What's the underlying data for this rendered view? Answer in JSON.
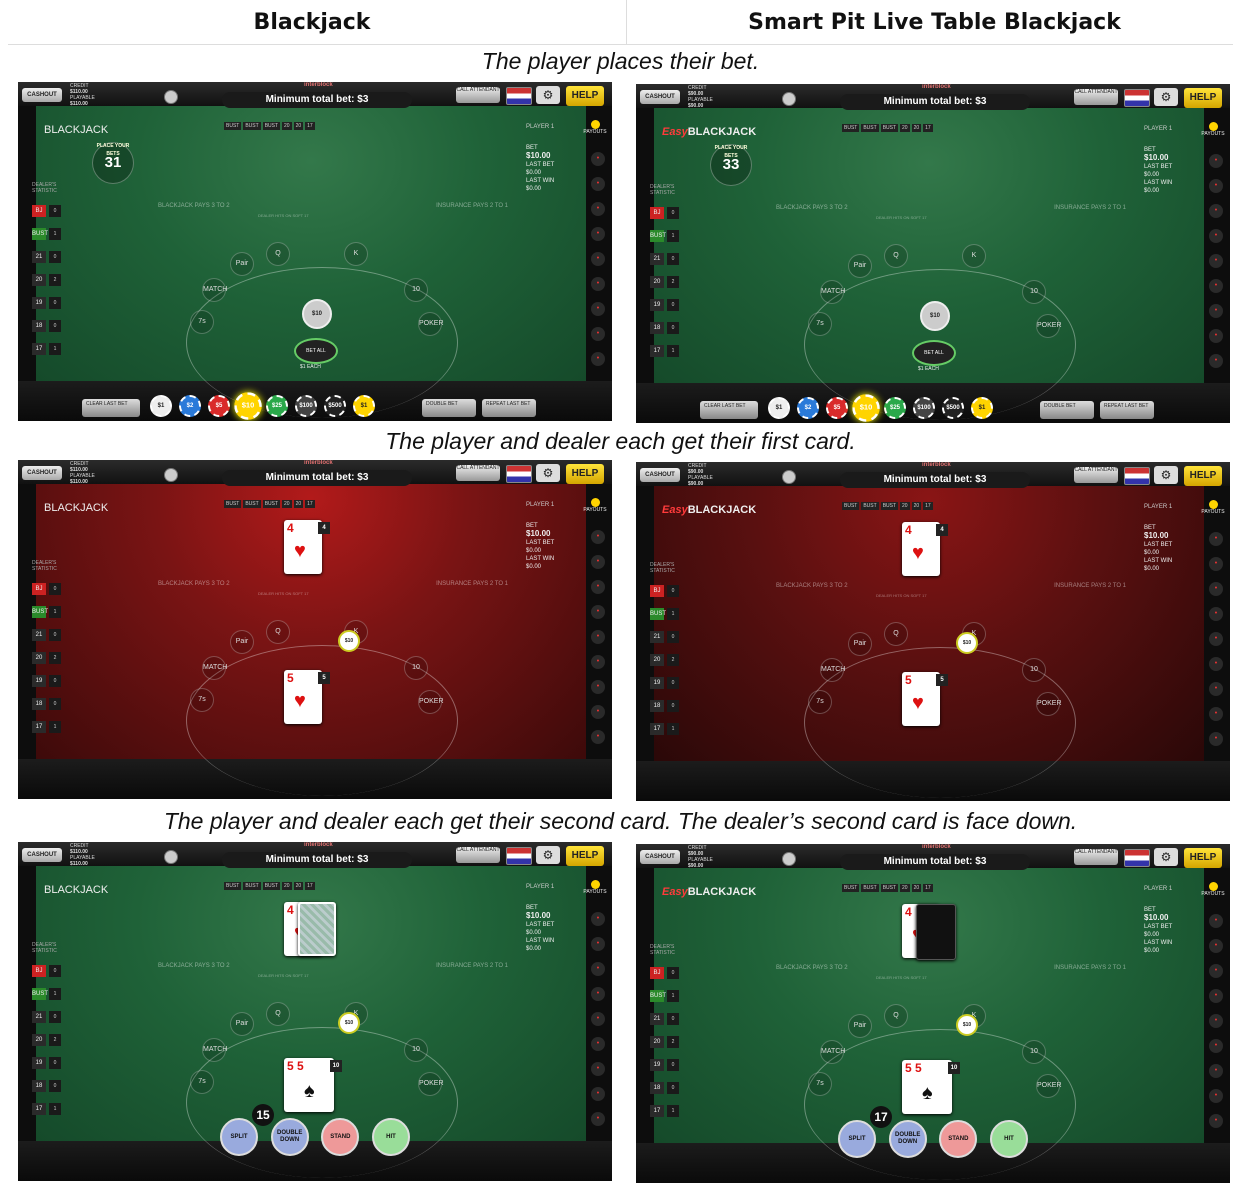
{
  "columns": {
    "left": "Blackjack",
    "right": "Smart Pit Live Table Blackjack"
  },
  "captions": [
    "The player places their bet.",
    "The player and dealer each get their first card.",
    "The player and dealer each get their second card. The dealer’s second card is face down."
  ],
  "ui": {
    "cashout": "CASHOUT",
    "min_bet": "Minimum total bet: $3",
    "brand": "interblock",
    "call_attendant": "CALL ATTENDANT",
    "help": "HELP",
    "player": "PLAYER 1",
    "payouts": "PAYOUTS",
    "dealer_stats": "DEALER'S STATISTIC",
    "insurance_left": "BLACKJACK PAYS 3 TO 2",
    "insurance_right": "INSURANCE PAYS 2 TO 1",
    "dealer_hits": "DEALER HITS ON SOFT 17",
    "history": [
      "BUST",
      "BUST",
      "BUST",
      "20",
      "20",
      "17"
    ],
    "clear": "CLEAR LAST BET",
    "double_bet": "DOUBLE BET",
    "repeat": "REPEAT LAST BET",
    "bet_all": "BET ALL",
    "each": "$1 EACH",
    "place_bets": "PLACE YOUR BETS",
    "bet_label": "BET",
    "last_bet": "LAST BET",
    "last_win": "LAST WIN",
    "last_bet_value": "$0.00",
    "last_win_value": "$0.00",
    "side_bets": [
      "Pair",
      "Q",
      "MATCH",
      "7s",
      "K",
      "10",
      "POKER"
    ],
    "chips": [
      "$1",
      "$2",
      "$5",
      "$10",
      "$25",
      "$100",
      "$500",
      "$1"
    ],
    "actions": [
      "SPLIT",
      "DOUBLE DOWN",
      "STAND",
      "HIT"
    ]
  },
  "left": {
    "game": "BLACKJACK",
    "credit": "$110.00",
    "playable": "$110.00",
    "bet": "$10.00",
    "timer": "31",
    "first_dealer_card": "4",
    "first_player_card": "5",
    "second_player_card": "5",
    "player_score": "15"
  },
  "right": {
    "game_prefix": "Easy",
    "game": "BLACKJACK",
    "credit": "$90.00",
    "playable": "$90.00",
    "bet": "$10.00",
    "timer": "33",
    "first_dealer_card": "4",
    "first_player_card": "5",
    "second_player_card": "5",
    "player_score": "17"
  },
  "stats": [
    {
      "k": "BJ",
      "v": "0"
    },
    {
      "k": "BUST",
      "v": "1"
    },
    {
      "k": "21",
      "v": "0"
    },
    {
      "k": "20",
      "v": "2"
    },
    {
      "k": "19",
      "v": "0"
    },
    {
      "k": "18",
      "v": "0"
    },
    {
      "k": "17",
      "v": "1"
    }
  ],
  "colors": {
    "felt_green": "#1f6238",
    "felt_red": "#7a1414",
    "help": "#ffd400"
  }
}
